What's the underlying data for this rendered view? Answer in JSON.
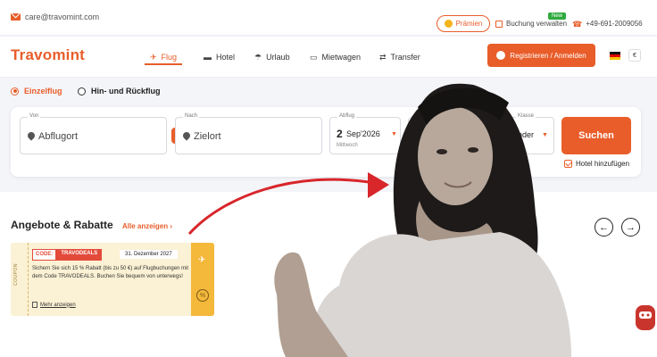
{
  "topbar": {
    "email": "care@travomint.com",
    "praemien": "Prämien",
    "booking": "Buchung verwalten",
    "new_badge": "New",
    "phone": "+49-691-2009056"
  },
  "nav": {
    "logo": "Travomint",
    "items": [
      {
        "label": "Flug",
        "icon": "plane-icon",
        "active": true
      },
      {
        "label": "Hotel",
        "icon": "bed-icon",
        "active": false
      },
      {
        "label": "Urlaub",
        "icon": "umbrella-icon",
        "active": false
      },
      {
        "label": "Mietwagen",
        "icon": "car-icon",
        "active": false
      },
      {
        "label": "Transfer",
        "icon": "transfer-icon",
        "active": false
      }
    ],
    "register": "Registrieren / Anmelden",
    "currency": "€"
  },
  "trip_type": {
    "one_way": "Einzelflug",
    "round_trip": "Hin- und Rückflug",
    "selected": "Einzelflug"
  },
  "search": {
    "from_label": "Von",
    "from_placeholder": "Abflugort",
    "to_label": "Nach",
    "to_placeholder": "Zielort",
    "date_label": "Abflug",
    "date_day": "2",
    "date_month_year": "Sep'2026",
    "date_weekday": "Mittwoch",
    "class_label": "Klasse",
    "class_value": "nder",
    "submit": "Suchen",
    "hotel_checkbox": "Hotel hinzufügen",
    "hotel_checked": true
  },
  "offers": {
    "title": "Angebote & Rabatte",
    "see_all": "Alle anzeigen",
    "coupon": {
      "side_label": "COUPON",
      "code_prefix": "CODE:",
      "code": "TRAVODEALS",
      "date": "31. Dezember 2027",
      "text": "Sichern Sie sich 15 % Rabatt (bis zu 50 €) auf Flugbuchungen mit dem Code TRAVODEALS. Buchen Sie bequem von unterwegs!",
      "more": "Mehr anzeigen",
      "stub_symbol": "%"
    }
  },
  "colors": {
    "accent": "#e85d2a",
    "coupon_bg": "#fbf1d4",
    "coupon_stub": "#f4b83b",
    "code_red": "#e34a3a"
  }
}
